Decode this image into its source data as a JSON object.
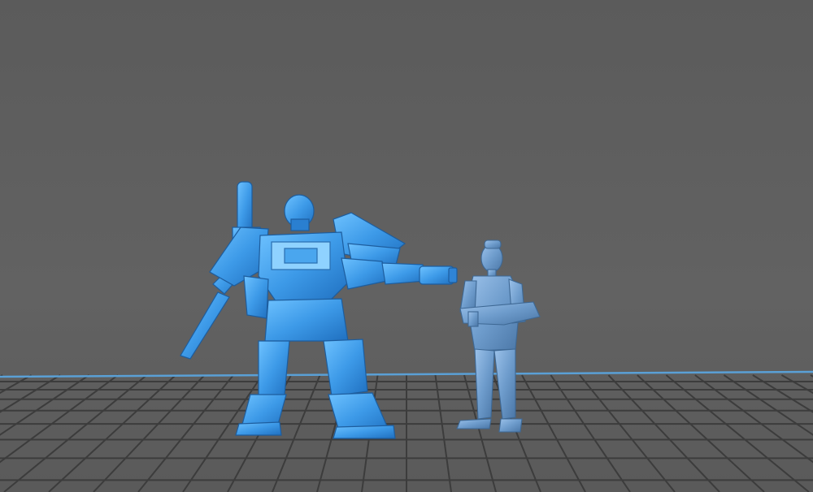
{
  "viewport": {
    "background_color": "#5e5e5e",
    "grid_line_color": "#3c3c3c",
    "horizon_line_color": "#5aa0d6"
  },
  "models": [
    {
      "name": "mech-robot-miniature",
      "color": "#3d9ae8"
    },
    {
      "name": "soldier-figure-miniature",
      "color": "#6e9ccc"
    }
  ]
}
